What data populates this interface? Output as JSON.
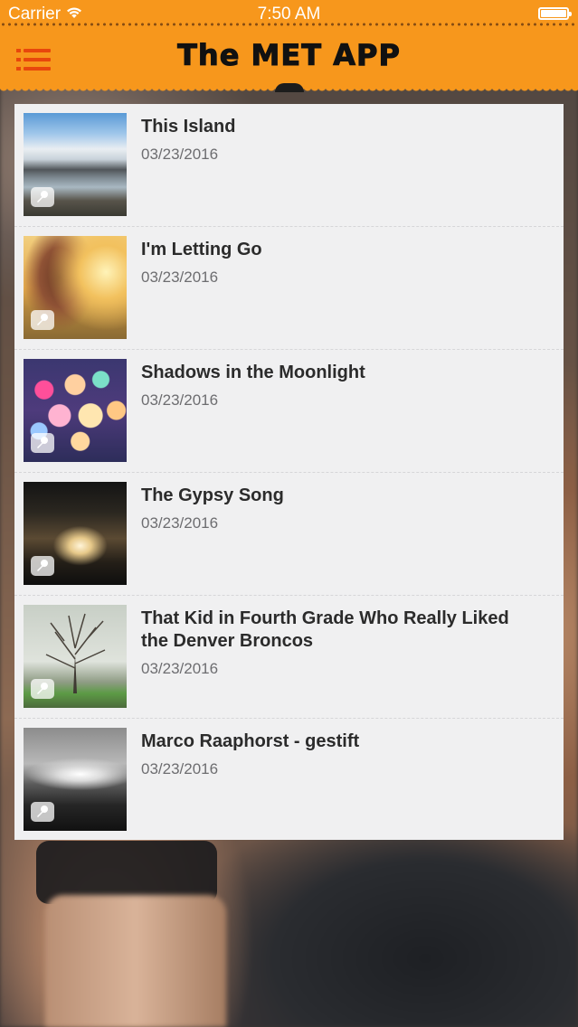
{
  "status_bar": {
    "carrier": "Carrier",
    "time": "7:50 AM"
  },
  "nav": {
    "title": "The MET APP",
    "menu_icon": "menu-list-icon",
    "accent_color": "#f7971c",
    "menu_color": "#e8470c"
  },
  "items": [
    {
      "title": "This Island",
      "date": "03/23/2016",
      "thumb": "lake-mountains-photo"
    },
    {
      "title": "I'm Letting Go",
      "date": "03/23/2016",
      "thumb": "sunset-girl-photo"
    },
    {
      "title": "Shadows in the Moonlight",
      "date": "03/23/2016",
      "thumb": "bokeh-lights-photo"
    },
    {
      "title": "The Gypsy Song",
      "date": "03/23/2016",
      "thumb": "concert-crowd-photo"
    },
    {
      "title": "That Kid in Fourth Grade Who Really Liked the Denver Broncos",
      "date": "03/23/2016",
      "thumb": "bare-tree-photo"
    },
    {
      "title": "Marco Raaphorst - gestift",
      "date": "03/23/2016",
      "thumb": "bw-landscape-photo"
    }
  ]
}
